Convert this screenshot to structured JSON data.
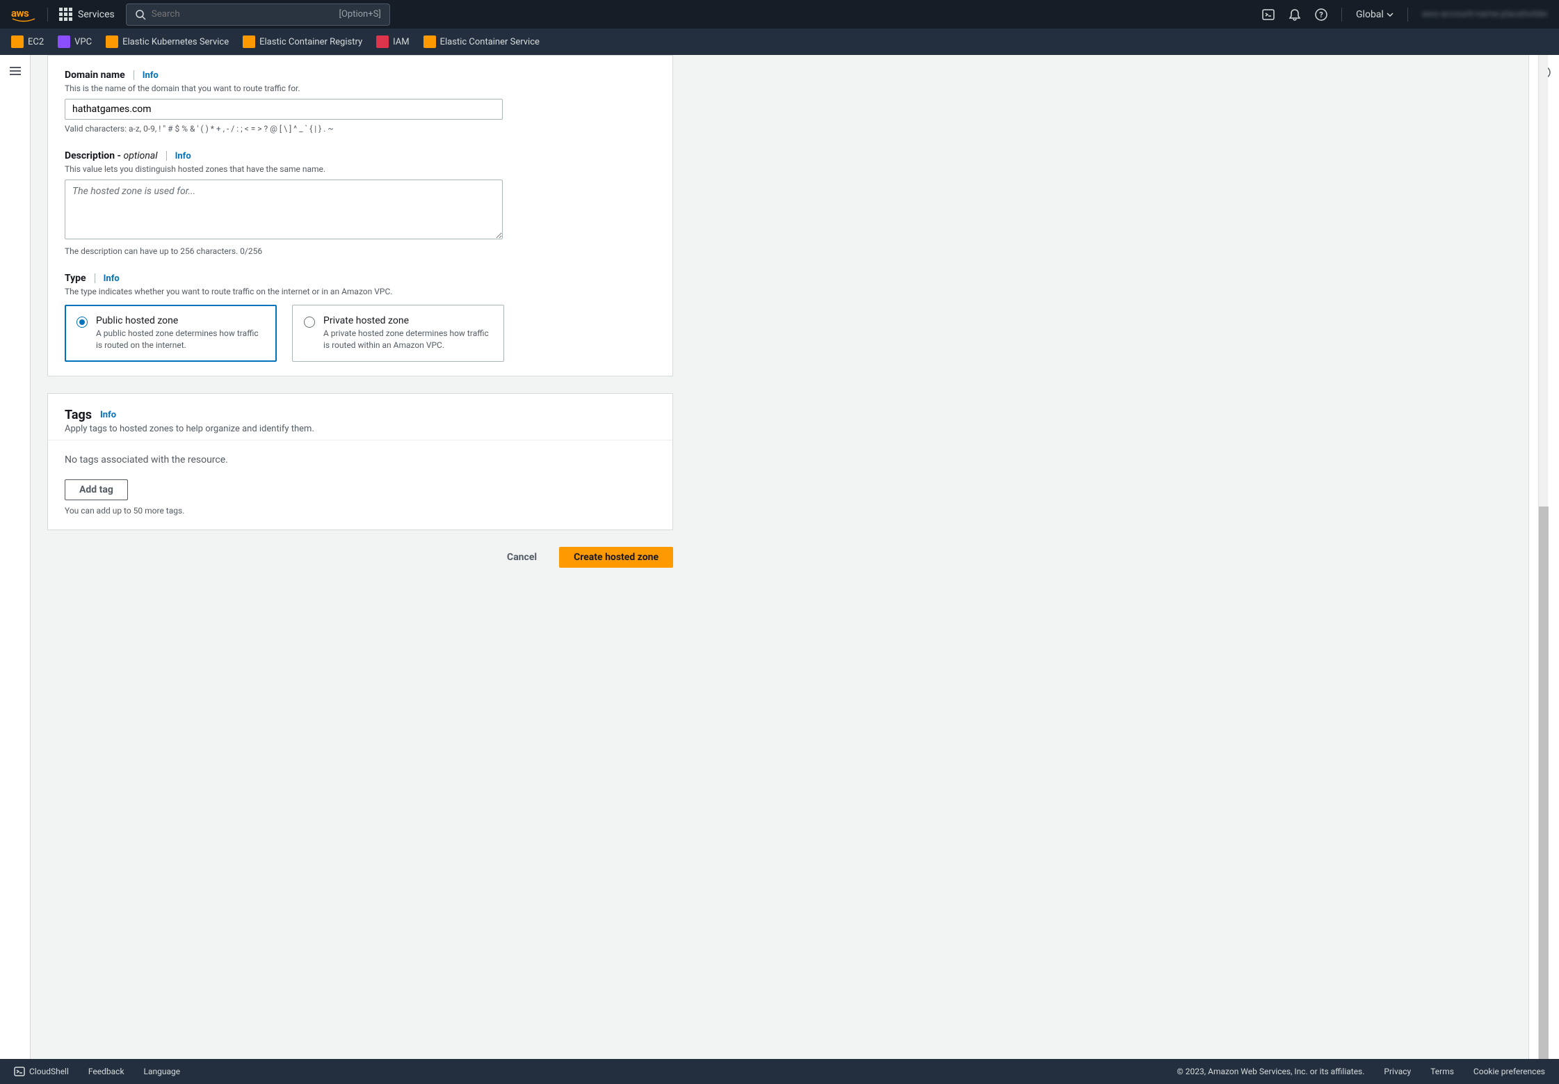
{
  "nav": {
    "logo": "aws",
    "services_label": "Services",
    "search_placeholder": "Search",
    "search_shortcut": "[Option+S]",
    "region": "Global",
    "account": "aws-account-name-placeholder"
  },
  "services_bar": {
    "items": [
      {
        "label": "EC2",
        "icon": "ec2"
      },
      {
        "label": "VPC",
        "icon": "vpc"
      },
      {
        "label": "Elastic Kubernetes Service",
        "icon": "eks"
      },
      {
        "label": "Elastic Container Registry",
        "icon": "ecr"
      },
      {
        "label": "IAM",
        "icon": "iam"
      },
      {
        "label": "Elastic Container Service",
        "icon": "ecs"
      }
    ]
  },
  "form": {
    "domain": {
      "label": "Domain name",
      "info": "Info",
      "hint": "This is the name of the domain that you want to route traffic for.",
      "value": "hathatgames.com",
      "helper": "Valid characters: a-z, 0-9, ! \" # $ % & ' ( ) * + , - / : ; < = > ? @ [ \\ ] ^ _ ` { | } . ~"
    },
    "description": {
      "label": "Description - ",
      "optional": "optional",
      "info": "Info",
      "hint": "This value lets you distinguish hosted zones that have the same name.",
      "placeholder": "The hosted zone is used for...",
      "helper": "The description can have up to 256 characters. 0/256"
    },
    "type": {
      "label": "Type",
      "info": "Info",
      "hint": "The type indicates whether you want to route traffic on the internet or in an Amazon VPC.",
      "public": {
        "title": "Public hosted zone",
        "desc": "A public hosted zone determines how traffic is routed on the internet."
      },
      "private": {
        "title": "Private hosted zone",
        "desc": "A private hosted zone determines how traffic is routed within an Amazon VPC."
      }
    }
  },
  "tags": {
    "title": "Tags",
    "info": "Info",
    "subtitle": "Apply tags to hosted zones to help organize and identify them.",
    "empty": "No tags associated with the resource.",
    "add_button": "Add tag",
    "helper": "You can add up to 50 more tags."
  },
  "actions": {
    "cancel": "Cancel",
    "create": "Create hosted zone"
  },
  "footer": {
    "cloudshell": "CloudShell",
    "feedback": "Feedback",
    "language": "Language",
    "copyright": "© 2023, Amazon Web Services, Inc. or its affiliates.",
    "privacy": "Privacy",
    "terms": "Terms",
    "cookies": "Cookie preferences"
  }
}
